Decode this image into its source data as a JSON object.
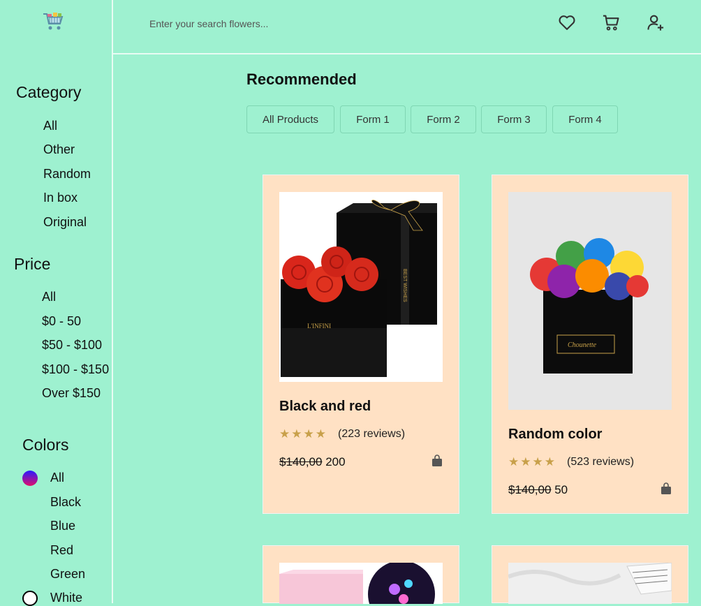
{
  "search": {
    "placeholder": "Enter your search flowers..."
  },
  "header": {
    "icons": [
      "heart-icon",
      "cart-icon",
      "user-add-icon"
    ]
  },
  "sidebar": {
    "category": {
      "title": "Category",
      "items": [
        "All",
        "Other",
        "Random",
        "In box",
        "Original"
      ]
    },
    "price": {
      "title": "Price",
      "items": [
        "All",
        "$0 - 50",
        "$50 - $100",
        "$100 - $150",
        "Over $150"
      ]
    },
    "colors": {
      "title": "Colors",
      "items": [
        {
          "label": "All",
          "color": "gradient"
        },
        {
          "label": "Black",
          "color": "#000000"
        },
        {
          "label": "Blue",
          "color": "#0000ff"
        },
        {
          "label": "Red",
          "color": "#ff0000"
        },
        {
          "label": "Green",
          "color": "#008000"
        },
        {
          "label": "White",
          "color": "#ffffff"
        }
      ]
    }
  },
  "main": {
    "heading": "Recommended",
    "filters": [
      "All Products",
      "Form 1",
      "Form 2",
      "Form 3",
      "Form 4"
    ]
  },
  "products": [
    {
      "title": "Black and red",
      "rating": 4,
      "reviews": "(223 reviews)",
      "old_price": "$140,00",
      "price": "200"
    },
    {
      "title": "Random color",
      "rating": 4,
      "reviews": "(523 reviews)",
      "old_price": "$140,00",
      "price": "50"
    }
  ],
  "colors": {
    "background": "#9ef1d0",
    "card": "#ffe1c4",
    "star": "#c8a04a"
  }
}
